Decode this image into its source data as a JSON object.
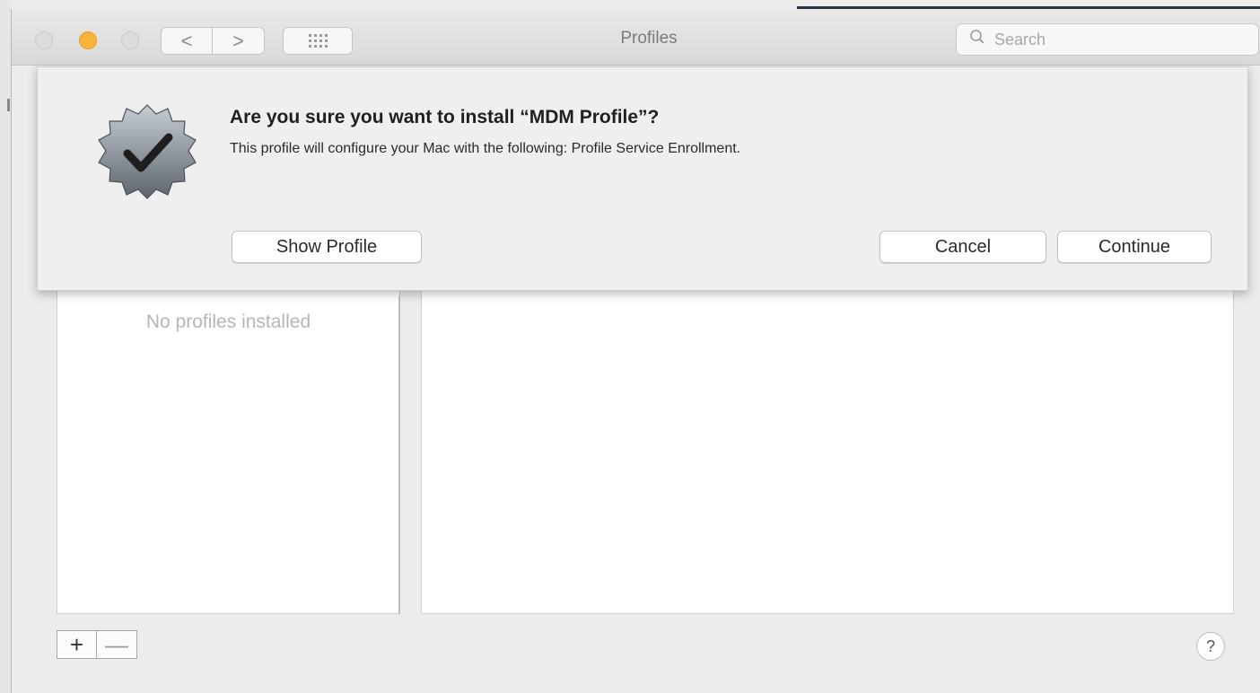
{
  "window": {
    "title": "Profiles"
  },
  "toolbar": {
    "back_icon": "chevron-left-icon",
    "forward_icon": "chevron-right-icon",
    "grid_icon": "show-all-grid-icon",
    "back_glyph": "<",
    "forward_glyph": ">"
  },
  "search": {
    "placeholder": "Search",
    "value": ""
  },
  "traffic_lights": {
    "close_color": "#dcdcdc",
    "minimize_color": "#f8b33a",
    "zoom_color": "#dcdcdc"
  },
  "sidebar": {
    "empty_text": "No profiles installed"
  },
  "bottom": {
    "add_label": "+",
    "remove_label": "—",
    "help_label": "?"
  },
  "dialog": {
    "icon": "verified-badge-checkmark-icon",
    "title": "Are you sure you want to install “MDM Profile”?",
    "message": "This profile will configure your Mac with the following: Profile Service Enrollment.",
    "buttons": {
      "show_profile": "Show Profile",
      "cancel": "Cancel",
      "continue": "Continue"
    }
  }
}
